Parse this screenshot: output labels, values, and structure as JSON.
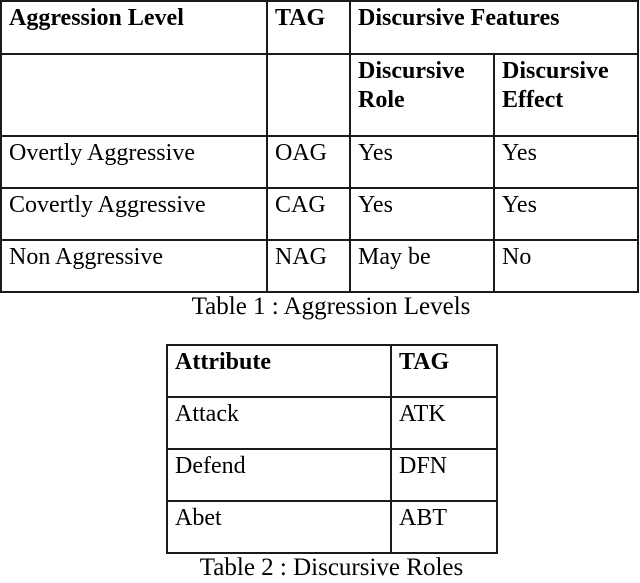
{
  "table1": {
    "caption": "Table 1 : Aggression Levels",
    "header": {
      "aggression_level": "Aggression Level",
      "tag": "TAG",
      "discursive_features": "Discursive Features",
      "discursive_role": "Discursive Role",
      "discursive_effect": "Discursive Effect"
    },
    "rows": [
      {
        "level": "Overtly Aggressive",
        "tag": "OAG",
        "role": "Yes",
        "effect": "Yes"
      },
      {
        "level": "Covertly Aggressive",
        "tag": "CAG",
        "role": "Yes",
        "effect": "Yes"
      },
      {
        "level": "Non Aggressive",
        "tag": "NAG",
        "role": "May be",
        "effect": "No"
      }
    ]
  },
  "table2": {
    "caption": "Table 2 : Discursive Roles",
    "header": {
      "attribute": "Attribute",
      "tag": "TAG"
    },
    "rows": [
      {
        "attribute": "Attack",
        "tag": "ATK"
      },
      {
        "attribute": "Defend",
        "tag": "DFN"
      },
      {
        "attribute": "Abet",
        "tag": "ABT"
      }
    ]
  }
}
